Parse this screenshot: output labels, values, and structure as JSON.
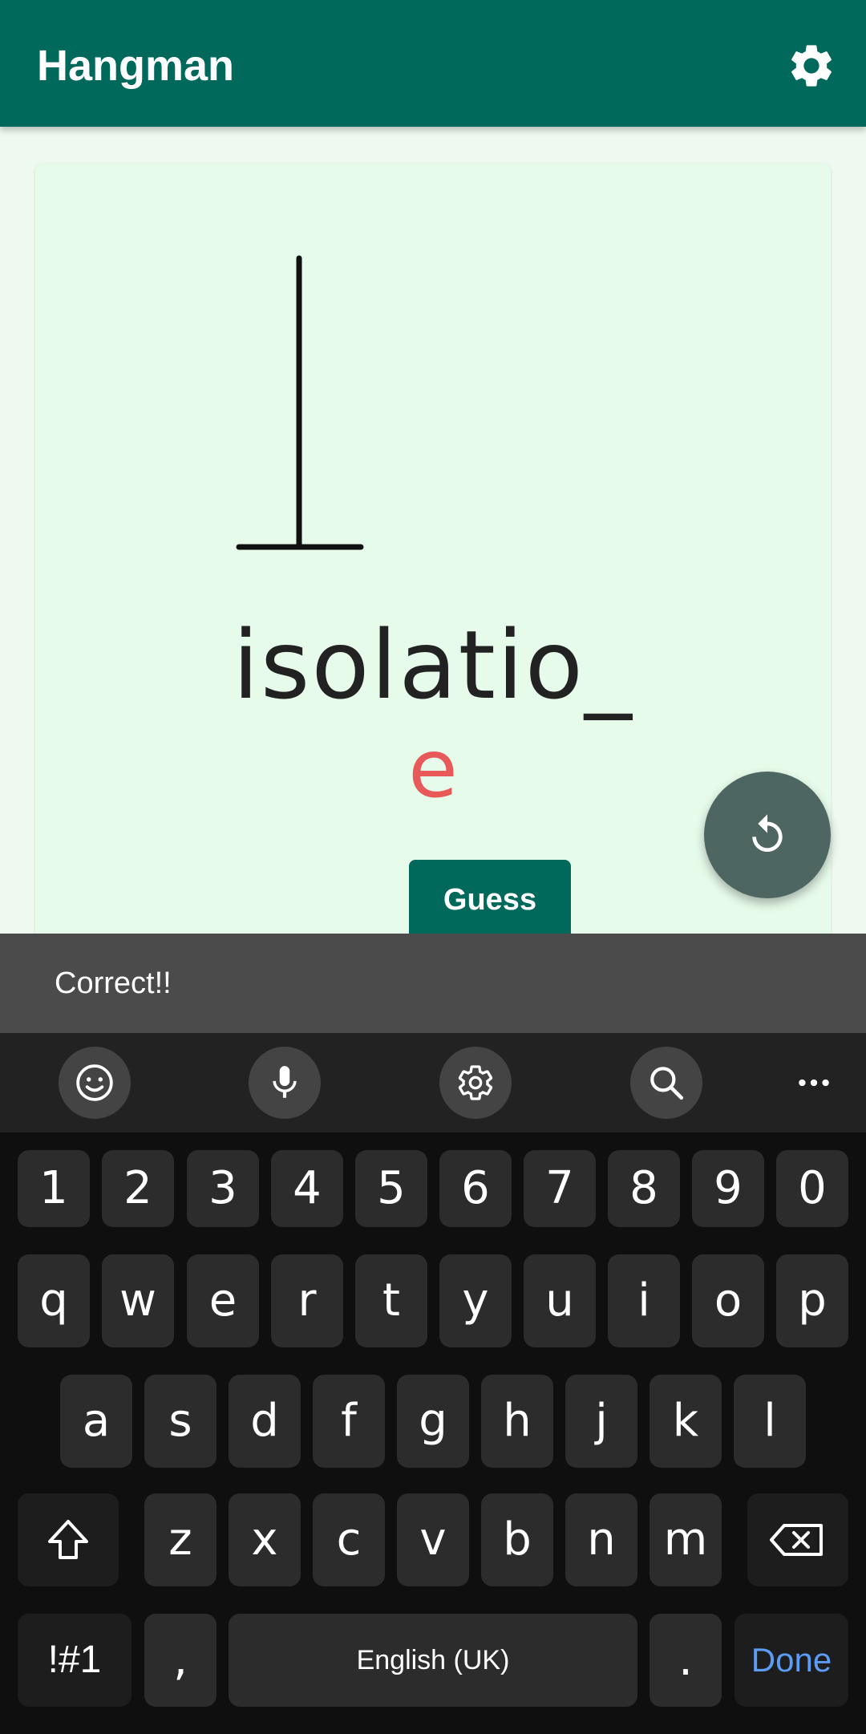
{
  "appbar": {
    "title": "Hangman",
    "settings_icon": "gear-icon"
  },
  "game": {
    "word": "isolatio_",
    "guess": "e",
    "guess_button": "Guess",
    "restart_icon": "restart-icon"
  },
  "snackbar": {
    "message": "Correct!!"
  },
  "keyboard": {
    "toolbar": [
      "emoji-icon",
      "mic-icon",
      "settings-icon",
      "search-icon",
      "more-icon"
    ],
    "numbers": [
      "1",
      "2",
      "3",
      "4",
      "5",
      "6",
      "7",
      "8",
      "9",
      "0"
    ],
    "row1": [
      "q",
      "w",
      "e",
      "r",
      "t",
      "y",
      "u",
      "i",
      "o",
      "p"
    ],
    "row2": [
      "a",
      "s",
      "d",
      "f",
      "g",
      "h",
      "j",
      "k",
      "l"
    ],
    "row3": [
      "z",
      "x",
      "c",
      "v",
      "b",
      "n",
      "m"
    ],
    "symbols": "!#1",
    "comma": ",",
    "space": "English (UK)",
    "period": ".",
    "done": "Done"
  },
  "colors": {
    "primary": "#00695c",
    "guess_letter": "#e85a5a",
    "fab": "#4e6661",
    "done": "#5c9cf5"
  }
}
